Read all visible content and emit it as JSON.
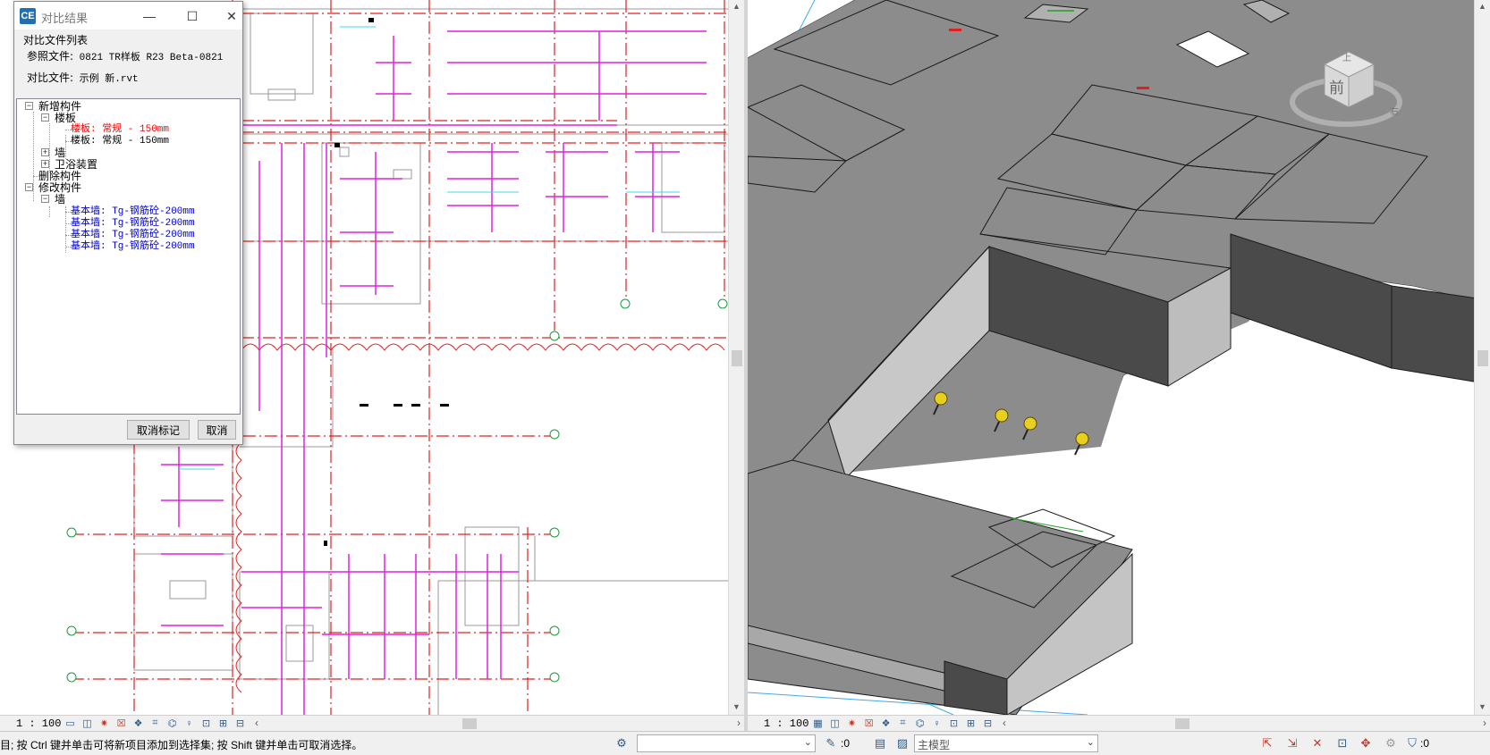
{
  "dialog": {
    "title": "对比结果",
    "minimize_glyph": "—",
    "maximize_glyph": "☐",
    "close_glyph": "✕",
    "group_label": "对比文件列表",
    "reference_label": "参照文件:",
    "reference_value": "0821 TR样板 R23 Beta-0821",
    "compare_label": "对比文件:",
    "compare_value": "示例 新.rvt",
    "unmark_button": "取消标记",
    "cancel_button": "取消"
  },
  "tree": {
    "added": "新增构件",
    "added_floor_group": "楼板",
    "added_floor_1": "楼板: 常规 - 150mm",
    "added_floor_2": "楼板: 常规 - 150mm",
    "added_wall_group": "墙",
    "added_plumbing_group": "卫浴装置",
    "deleted": "删除构件",
    "modified": "修改构件",
    "modified_wall_group": "墙",
    "modified_walls": [
      "基本墙: Tg-钢筋砼-200mm",
      "基本墙: Tg-钢筋砼-200mm",
      "基本墙: Tg-钢筋砼-200mm",
      "基本墙: Tg-钢筋砼-200mm"
    ]
  },
  "plan_view": {
    "scale": "1 : 100"
  },
  "model_view": {
    "scale": "1 : 100",
    "viewcube_label": "前",
    "compass_top": "上",
    "compass_right": "右"
  },
  "status_bar": {
    "hint": "目; 按 Ctrl 键并单击可将新项目添加到选择集; 按 Shift 键并单击可取消选择。",
    "filter_count_1": ":0",
    "model_selector": "主模型",
    "filter_count_2": ":0"
  },
  "colors": {
    "grid_red": "#e02020",
    "pipe_magenta": "#e020e0",
    "slab_top": "#8c8c8c",
    "wall_dark": "#4a4a4a",
    "accent_blue": "#0000cc"
  }
}
